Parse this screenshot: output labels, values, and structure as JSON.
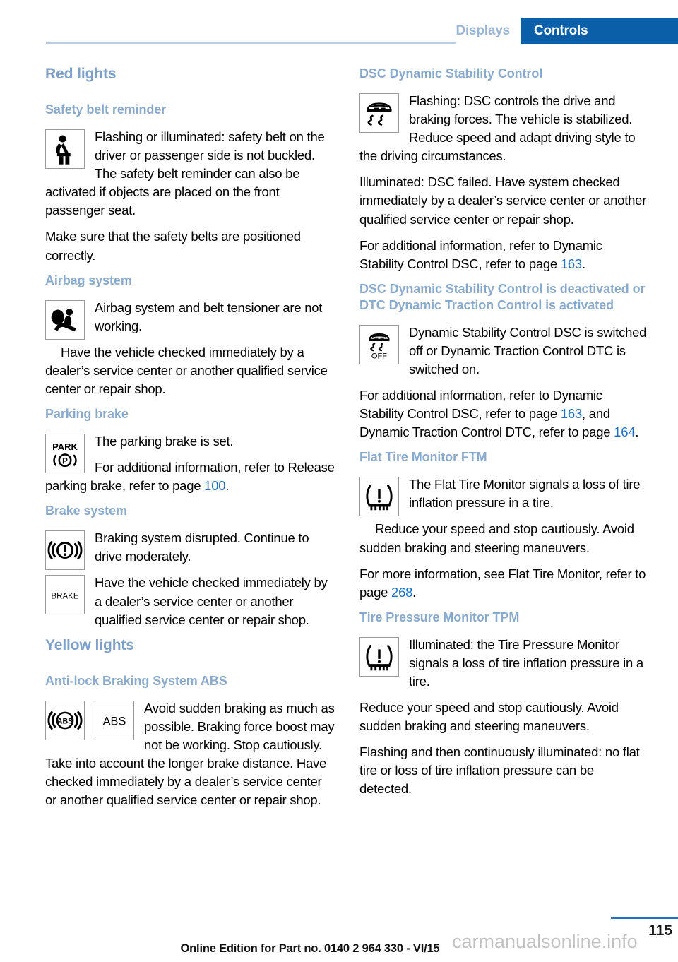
{
  "header": {
    "tab_inactive": "Displays",
    "tab_active": "Controls",
    "accent_blue": "#0b5ea8",
    "muted_blue": "#9bb4d4"
  },
  "left_column": {
    "h1_red_lights": "Red lights",
    "safety_belt": {
      "heading": "Safety belt reminder",
      "icon": "seatbelt-reminder-icon",
      "p1": "Flashing or illuminated: safety belt on the driver or passenger side is not buckled. The safety belt reminder can also be activated if objects are placed on the front passenger seat.",
      "p2": "Make sure that the safety belts are positioned correctly."
    },
    "airbag": {
      "heading": "Airbag system",
      "icon": "airbag-system-icon",
      "p1": "Airbag system and belt tensioner are not working.",
      "p2": "Have the vehicle checked immediately by a dealer’s service center or another qualified service center or repair shop."
    },
    "parking_brake": {
      "heading": "Parking brake",
      "icon": "parking-brake-icon",
      "icon_label_top": "PARK",
      "icon_label_bottom": "((P))",
      "p1": "The parking brake is set.",
      "p2_before": "For additional information, refer to Release parking brake, refer to page ",
      "p2_page": "100",
      "p2_after": "."
    },
    "brake_system": {
      "heading": "Brake system",
      "icon1": "brake-warning-icon",
      "icon2": "brake-text-icon",
      "icon2_label": "BRAKE",
      "p1": "Braking system disrupted. Continue to drive moderately.",
      "p2": "Have the vehicle checked immediately by a dealer’s service center or another qualified service center or repair shop."
    },
    "h1_yellow_lights": "Yellow lights",
    "abs": {
      "heading": "Anti-lock Braking System ABS",
      "icon1": "abs-circle-icon",
      "icon1_label": "ABS",
      "icon2": "abs-text-icon",
      "icon2_label": "ABS",
      "p1": "Avoid sudden braking as much as possible. Braking force boost may not be working. Stop cautiously. Take into account the longer brake distance. Have checked immediately by a dealer’s service center or another qualified service center or repair shop."
    }
  },
  "right_column": {
    "dsc": {
      "heading": "DSC Dynamic Stability Control",
      "icon": "dsc-car-skid-icon",
      "p1": "Flashing: DSC controls the drive and braking forces. The vehicle is stabilized. Reduce speed and adapt driving style to the driving circumstances.",
      "p2": "Illuminated: DSC failed. Have system checked immediately by a dealer’s service center or another qualified service center or repair shop.",
      "p3_before": "For additional information, refer to Dynamic Stability Control DSC, refer to page ",
      "p3_page": "163",
      "p3_after": "."
    },
    "dsc_off": {
      "heading": "DSC Dynamic Stability Control is deactivated or DTC Dynamic Traction Control is activated",
      "icon": "dsc-off-icon",
      "icon_label": "OFF",
      "p1": "Dynamic Stability Control DSC is switched off or Dynamic Traction Control DTC is switched on.",
      "p2_before": "For additional information, refer to Dynamic Stability Control DSC, refer to page ",
      "p2_page1": "163",
      "p2_mid": ", and Dynamic Traction Control DTC, refer to page ",
      "p2_page2": "164",
      "p2_after": "."
    },
    "ftm": {
      "heading": "Flat Tire Monitor FTM",
      "icon": "tire-pressure-warning-icon",
      "p1": "The Flat Tire Monitor signals a loss of tire inflation pressure in a tire.",
      "p2": "Reduce your speed and stop cautiously. Avoid sudden braking and steering maneuvers.",
      "p3_before": "For more information, see Flat Tire Monitor, refer to page ",
      "p3_page": "268",
      "p3_after": "."
    },
    "tpm": {
      "heading": "Tire Pressure Monitor TPM",
      "icon": "tire-pressure-warning-icon",
      "p1": "Illuminated: the Tire Pressure Monitor signals a loss of tire inflation pressure in a tire.",
      "p2": "Reduce your speed and stop cautiously. Avoid sudden braking and steering maneuvers.",
      "p3": "Flashing and then continuously illuminated: no flat tire or loss of tire inflation pressure can be detected."
    }
  },
  "footer": {
    "page_number": "115",
    "note": "Online Edition for Part no. 0140 2 964 330 - VI/15",
    "watermark": "carmanualsonline.info"
  }
}
